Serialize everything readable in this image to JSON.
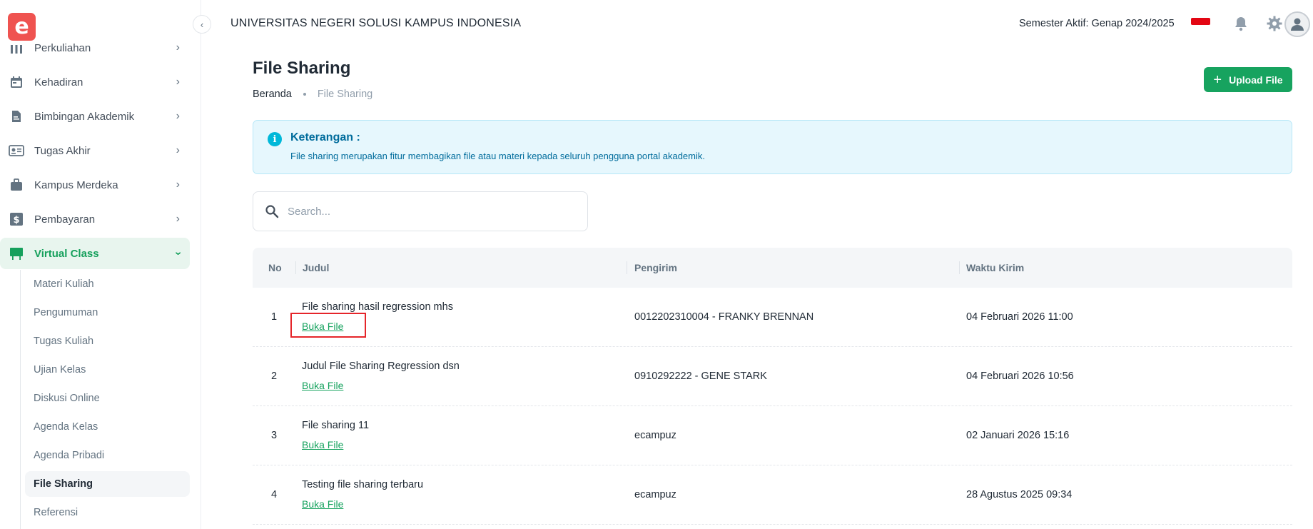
{
  "header": {
    "university": "UNIVERSITAS NEGERI SOLUSI KAMPUS INDONESIA",
    "semester": "Semester Aktif: Genap 2024/2025",
    "flag_color": "#e30613"
  },
  "sidebar": {
    "logo_letter": "e",
    "items": [
      {
        "label": "Perkuliahan",
        "icon": "building-icon"
      },
      {
        "label": "Kehadiran",
        "icon": "calendar-icon"
      },
      {
        "label": "Bimbingan Akademik",
        "icon": "document-icon"
      },
      {
        "label": "Tugas Akhir",
        "icon": "id-card-icon"
      },
      {
        "label": "Kampus Merdeka",
        "icon": "briefcase-icon"
      },
      {
        "label": "Pembayaran",
        "icon": "dollar-icon"
      },
      {
        "label": "Virtual Class",
        "icon": "board-icon"
      }
    ],
    "sub_items": [
      "Materi Kuliah",
      "Pengumuman",
      "Tugas Kuliah",
      "Ujian Kelas",
      "Diskusi Online",
      "Agenda Kelas",
      "Agenda Pribadi",
      "File Sharing",
      "Referensi"
    ]
  },
  "page": {
    "title": "File Sharing",
    "breadcrumb_home": "Beranda",
    "breadcrumb_current": "File Sharing",
    "upload_label": "Upload File"
  },
  "info": {
    "title": "Keterangan :",
    "text": "File sharing merupakan fitur membagikan file atau materi kepada seluruh pengguna portal akademik."
  },
  "search": {
    "placeholder": "Search..."
  },
  "table": {
    "headers": [
      "No",
      "Judul",
      "Pengirim",
      "Waktu Kirim"
    ],
    "rows": [
      {
        "no": "1",
        "title": "File sharing hasil regression mhs",
        "link": "Buka File",
        "sender": "0012202310004 - FRANKY BRENNAN",
        "time": "04 Februari 2026 11:00"
      },
      {
        "no": "2",
        "title": "Judul File Sharing Regression dsn",
        "link": "Buka File",
        "sender": "0910292222 - GENE STARK",
        "time": "04 Februari 2026 10:56"
      },
      {
        "no": "3",
        "title": "File sharing 11",
        "link": "Buka File",
        "sender": "ecampuz",
        "time": "02 Januari 2026 15:16"
      },
      {
        "no": "4",
        "title": "Testing file sharing terbaru",
        "link": "Buka File",
        "sender": "ecampuz",
        "time": "28 Agustus 2025 09:34"
      }
    ]
  },
  "colors": {
    "accent": "#17a35f",
    "info_bg": "#e6f7fd",
    "info_text": "#006c9c",
    "highlight": "#e5252a"
  }
}
